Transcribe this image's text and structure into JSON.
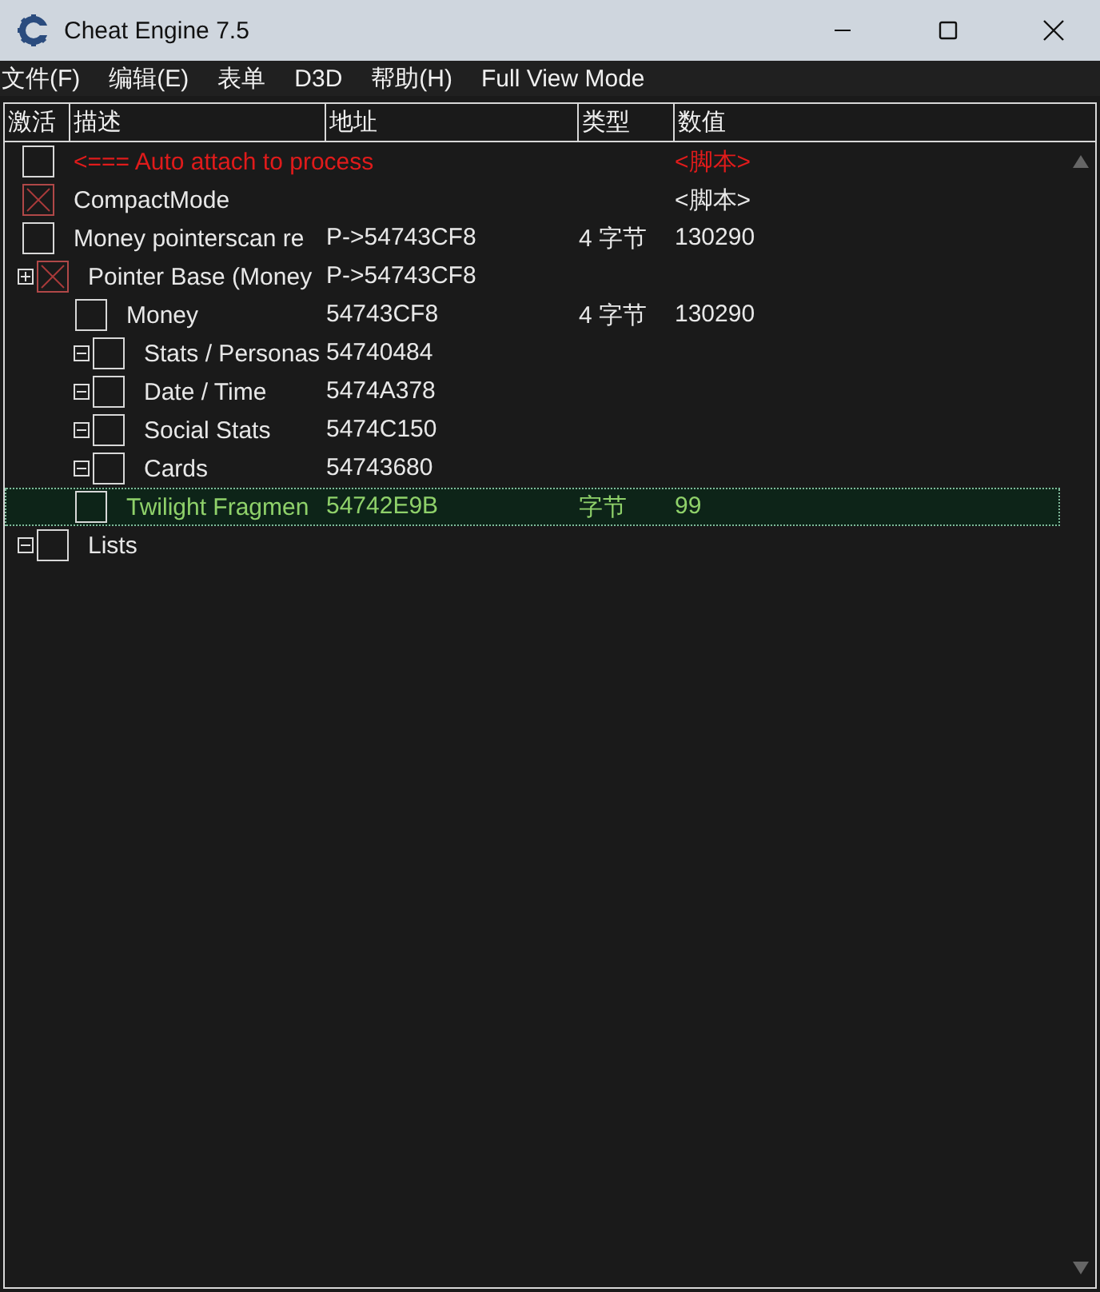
{
  "window": {
    "title": "Cheat Engine 7.5"
  },
  "menu": [
    "文件(F)",
    "编辑(E)",
    "表单",
    "D3D",
    "帮助(H)",
    "Full View Mode"
  ],
  "columns": [
    "激活",
    "描述",
    "地址",
    "类型",
    "数值"
  ],
  "rows": [
    {
      "checked": false,
      "selected": false,
      "color": "#e01b1b",
      "description": "<=== Auto attach to process",
      "value": "<脚本>"
    },
    {
      "checked": true,
      "selected": false,
      "color": "#e8e8e8",
      "description": "CompactMode",
      "value": "<脚本>"
    },
    {
      "checked": false,
      "selected": false,
      "color": "#e8e8e8",
      "description": "Money pointerscan re",
      "address": "P->54743CF8",
      "type": "4 字节",
      "value": "130290"
    },
    {
      "checked": true,
      "selected": false,
      "color": "#e8e8e8",
      "expanded": false,
      "description": "Pointer Base (Money",
      "address": "P->54743CF8",
      "children": [
        {
          "checked": false,
          "selected": false,
          "color": "#e8e8e8",
          "description": "Money",
          "address": "54743CF8",
          "type": "4 字节",
          "value": "130290"
        },
        {
          "checked": false,
          "selected": false,
          "color": "#e8e8e8",
          "expanded": true,
          "description": "Stats / Personas",
          "address": "54740484"
        },
        {
          "checked": false,
          "selected": false,
          "color": "#e8e8e8",
          "expanded": true,
          "description": "Date / Time",
          "address": "5474A378"
        },
        {
          "checked": false,
          "selected": false,
          "color": "#e8e8e8",
          "expanded": true,
          "description": "Social Stats",
          "address": "5474C150"
        },
        {
          "checked": false,
          "selected": false,
          "color": "#e8e8e8",
          "expanded": true,
          "description": "Cards",
          "address": "54743680"
        },
        {
          "checked": false,
          "selected": true,
          "color": "#8fd16a",
          "description": "Twilight Fragmen",
          "address": "54742E9B",
          "type": "字节",
          "value": "99"
        }
      ]
    },
    {
      "checked": false,
      "selected": false,
      "color": "#e8e8e8",
      "expanded": true,
      "description": "Lists"
    }
  ]
}
